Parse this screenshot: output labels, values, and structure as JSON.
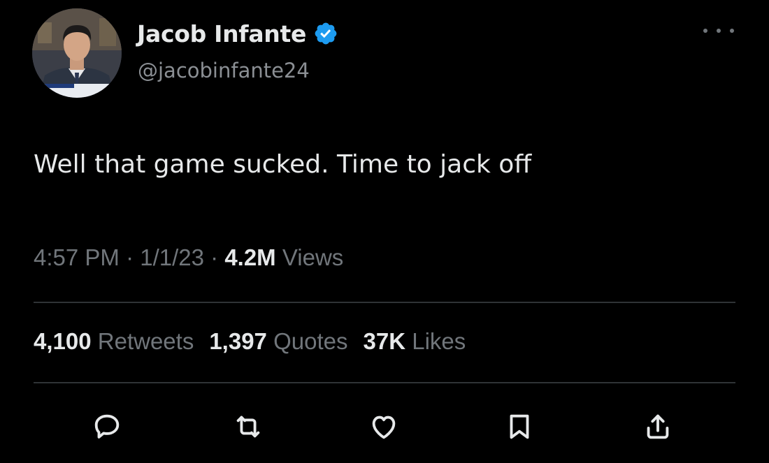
{
  "user": {
    "display_name": "Jacob Infante",
    "handle": "@jacobinfante24"
  },
  "tweet": {
    "text": "Well that game sucked. Time to jack off"
  },
  "meta": {
    "time": "4:57 PM",
    "sep1": " · ",
    "date": "1/1/23",
    "sep2": " · ",
    "views_count": "4.2M",
    "views_label": " Views"
  },
  "stats": {
    "retweets_count": "4,100",
    "retweets_label": " Retweets",
    "quotes_count": "1,397",
    "quotes_label": " Quotes",
    "likes_count": "37K",
    "likes_label": " Likes"
  },
  "icons": {
    "verified": "verified-badge-icon",
    "more": "more-options-icon",
    "reply": "reply-icon",
    "retweet": "retweet-icon",
    "like": "heart-icon",
    "bookmark": "bookmark-icon",
    "share": "share-icon"
  },
  "colors": {
    "background": "#000000",
    "text_primary": "#e7e9ea",
    "text_secondary": "#71767b",
    "verified_blue": "#1d9bf0",
    "divider": "#2f3336"
  }
}
